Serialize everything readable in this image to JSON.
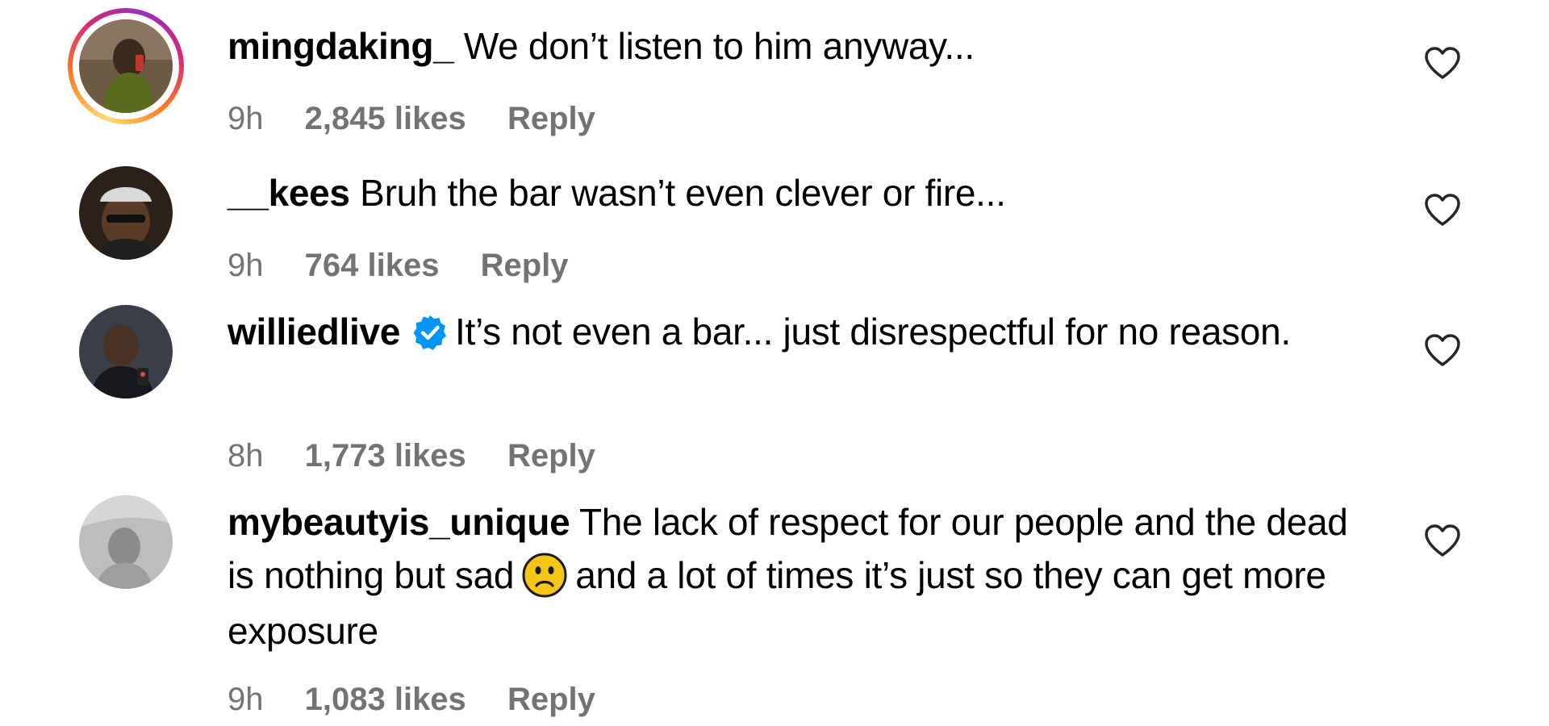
{
  "comments": [
    {
      "username": "mingdaking_",
      "text": " We don’t listen to him anyway...",
      "time": "9h",
      "likes": "2,845 likes",
      "reply": "Reply",
      "has_story": true,
      "verified": false,
      "avatar_icon": "avatar-photo-icon"
    },
    {
      "username": "__kees",
      "text": " Bruh the bar wasn’t even clever or fire...",
      "time": "9h",
      "likes": "764 likes",
      "reply": "Reply",
      "has_story": false,
      "verified": false,
      "avatar_icon": "avatar-photo-icon"
    },
    {
      "username": "williedlive",
      "text": "It’s not even a bar... just disrespectful for no reason.",
      "time": "8h",
      "likes": "1,773 likes",
      "reply": "Reply",
      "has_story": false,
      "verified": true,
      "avatar_icon": "avatar-photo-icon"
    },
    {
      "username": "mybeautyis_unique",
      "text_before_emoji": " The lack of respect for our people and the dead is nothing but sad",
      "emoji": "slightly-frowning-face-emoji",
      "text_after_emoji": "and a lot of times it’s just so they can get more exposure",
      "time": "9h",
      "likes": "1,083 likes",
      "reply": "Reply",
      "has_story": false,
      "verified": false,
      "avatar_icon": "avatar-photo-icon"
    }
  ],
  "icons": {
    "like": "heart-outline-icon",
    "verified": "verified-badge-icon"
  },
  "colors": {
    "text": "#000000",
    "meta_text": "#737373",
    "verified_blue": "#0095f6",
    "story_ring_start": "#feda75",
    "story_ring_end": "#d62976"
  }
}
